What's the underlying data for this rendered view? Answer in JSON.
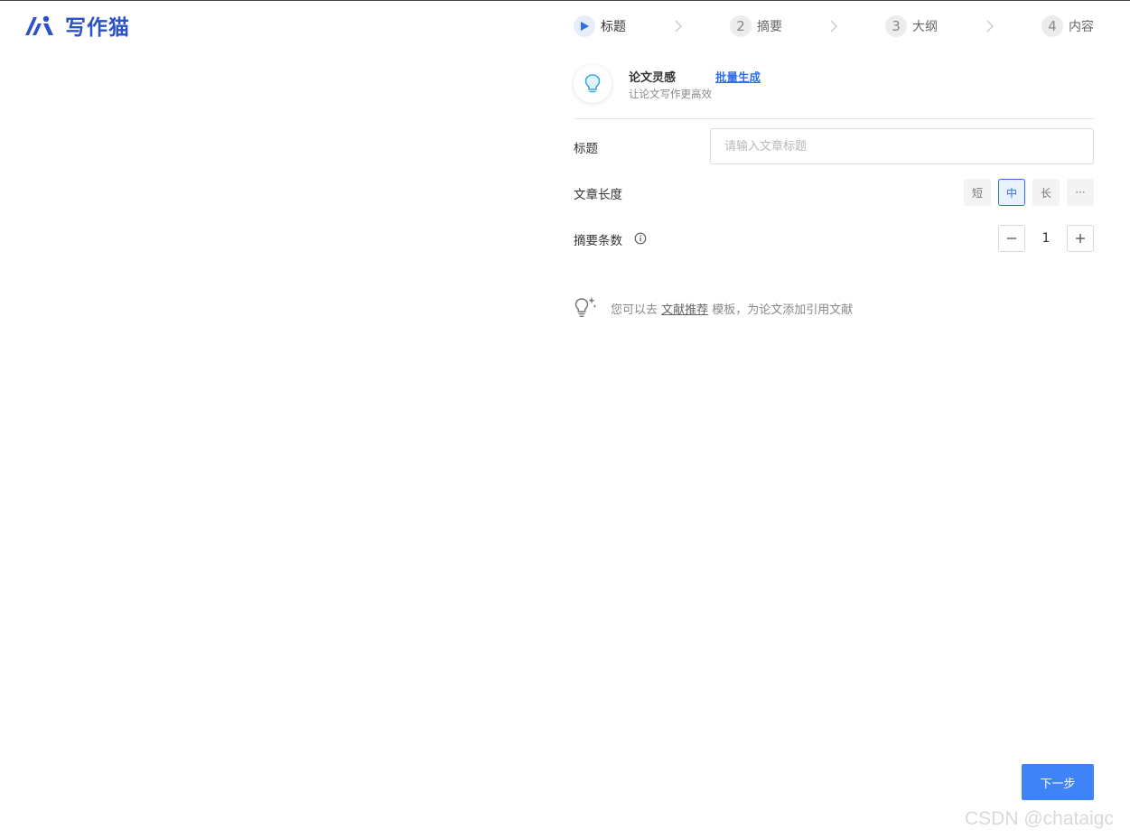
{
  "logo": {
    "text": "写作猫",
    "icon": "ai-logo-icon"
  },
  "steps": [
    {
      "number": "",
      "label": "标题",
      "active": true,
      "icon": "play-icon"
    },
    {
      "number": "2",
      "label": "摘要",
      "active": false
    },
    {
      "number": "3",
      "label": "大纲",
      "active": false
    },
    {
      "number": "4",
      "label": "内容",
      "active": false
    }
  ],
  "inspiration": {
    "title": "论文灵感",
    "link": "批量生成",
    "subtitle": "让论文写作更高效",
    "icon": "lightbulb-icon"
  },
  "form": {
    "title_label": "标题",
    "title_placeholder": "请输入文章标题",
    "title_value": "",
    "length_label": "文章长度",
    "length_options": [
      "短",
      "中",
      "长",
      "···"
    ],
    "length_selected": "中",
    "count_label": "摘要条数",
    "count_value": "1",
    "decrement": "−",
    "increment": "+"
  },
  "hint": {
    "prefix": "您可以去 ",
    "link": "文献推荐",
    "suffix": " 模板，为论文添加引用文献",
    "icon": "lightbulb-sparkle-icon"
  },
  "next_button": "下一步",
  "watermark": "CSDN @chataigc",
  "colors": {
    "brand": "#2b52c9",
    "accent": "#3f84f6",
    "link": "#2f6ee8"
  }
}
